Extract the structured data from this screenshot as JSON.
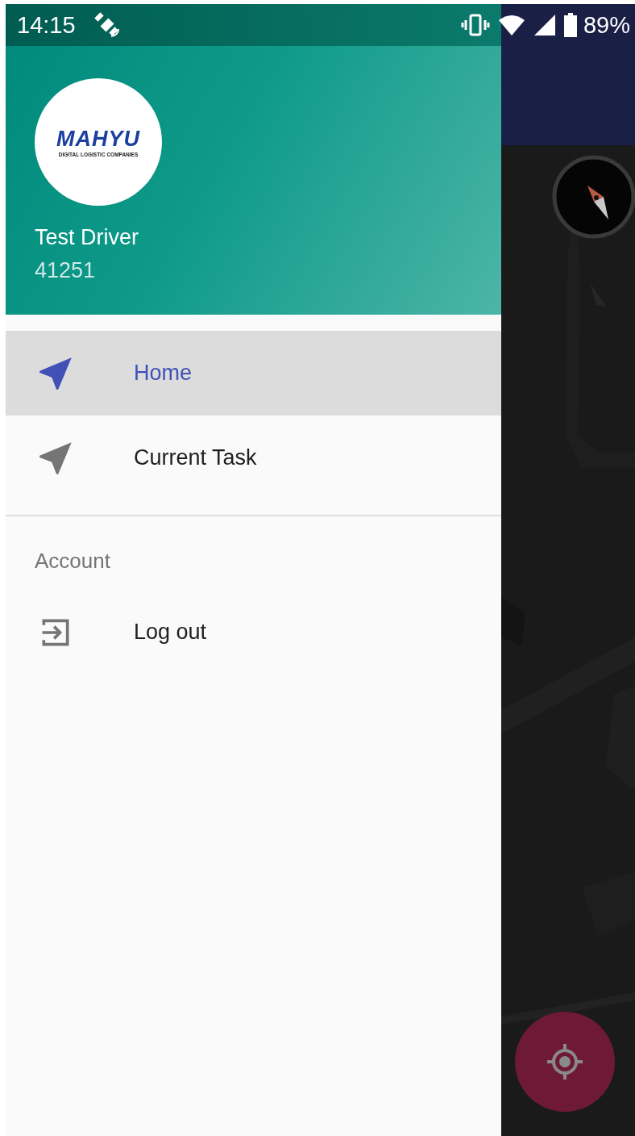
{
  "status_bar": {
    "time": "14:15",
    "battery": "89%"
  },
  "drawer": {
    "header": {
      "logo": {
        "title": "MAHYU",
        "subtitle": "DIGITAL LOGISTIC COMPANIES"
      },
      "name": "Test Driver",
      "id": "41251"
    },
    "items": [
      {
        "label": "Home",
        "selected": true,
        "kind": "navigate"
      },
      {
        "label": "Current Task",
        "selected": false,
        "kind": "navigate"
      }
    ],
    "sections": [
      {
        "title": "Account",
        "items": [
          {
            "label": "Log out",
            "selected": false,
            "kind": "logout"
          }
        ]
      }
    ]
  }
}
